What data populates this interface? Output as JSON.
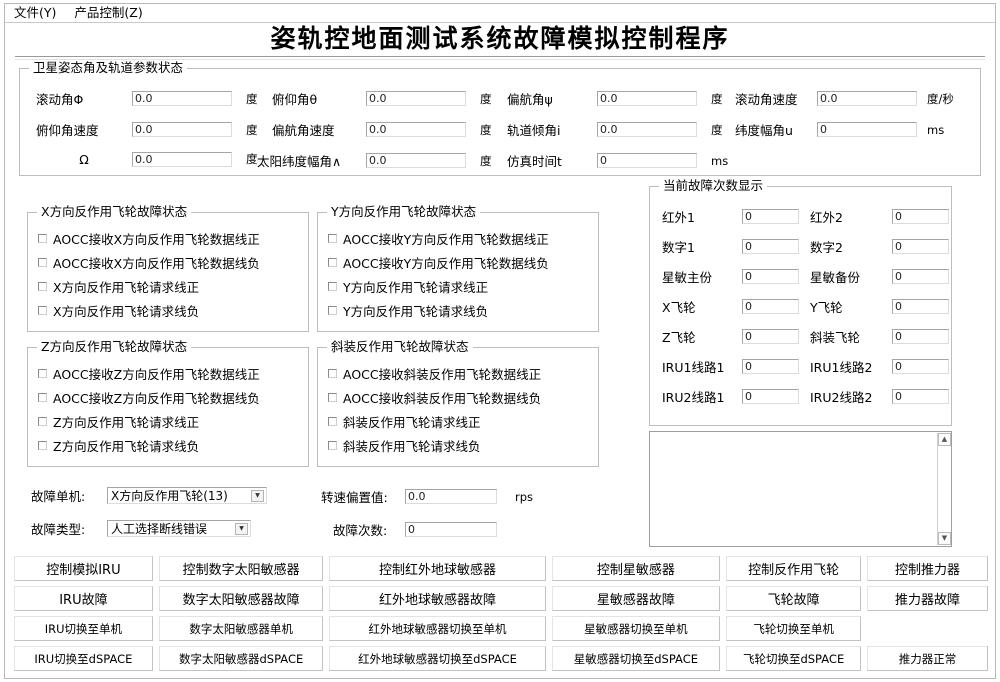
{
  "menu": {
    "items": [
      {
        "label": "文件(Y)",
        "name": "menu-file"
      },
      {
        "label": "产品控制(Z)",
        "name": "menu-product-control"
      }
    ]
  },
  "title": "姿轨控地面测试系统故障模拟控制程序",
  "attitude_group": {
    "legend": "卫星姿态角及轨道参数状态",
    "fields": [
      {
        "label": "滚动角Φ",
        "value": "0.0",
        "unit": "度"
      },
      {
        "label": "俯仰角θ",
        "value": "0.0",
        "unit": "度"
      },
      {
        "label": "偏航角ψ",
        "value": "0.0",
        "unit": "度"
      },
      {
        "label": "滚动角速度",
        "value": "0.0",
        "unit": "度/秒"
      },
      {
        "label": "俯仰角速度",
        "value": "0.0",
        "unit": "度"
      },
      {
        "label": "偏航角速度",
        "value": "0.0",
        "unit": "度"
      },
      {
        "label": "轨道倾角i",
        "value": "0.0",
        "unit": "度"
      },
      {
        "label": "纬度幅角u",
        "value": "0",
        "unit": "ms"
      },
      {
        "label": "Ω",
        "value": "0.0",
        "unit": "度"
      },
      {
        "label": "太阳纬度幅角∧",
        "value": "0.0",
        "unit": "度"
      },
      {
        "label": "仿真时间t",
        "value": "0",
        "unit": "ms"
      }
    ]
  },
  "wheel_groups": [
    {
      "legend": "X方向反作用飞轮故障状态",
      "checks": [
        "AOCC接收X方向反作用飞轮数据线正",
        "AOCC接收X方向反作用飞轮数据线负",
        "X方向反作用飞轮请求线正",
        "X方向反作用飞轮请求线负"
      ]
    },
    {
      "legend": "Y方向反作用飞轮故障状态",
      "checks": [
        "AOCC接收Y方向反作用飞轮数据线正",
        "AOCC接收Y方向反作用飞轮数据线负",
        "Y方向反作用飞轮请求线正",
        "Y方向反作用飞轮请求线负"
      ]
    },
    {
      "legend": "Z方向反作用飞轮故障状态",
      "checks": [
        "AOCC接收Z方向反作用飞轮数据线正",
        "AOCC接收Z方向反作用飞轮数据线负",
        "Z方向反作用飞轮请求线正",
        "Z方向反作用飞轮请求线负"
      ]
    },
    {
      "legend": "斜装反作用飞轮故障状态",
      "checks": [
        "AOCC接收斜装反作用飞轮数据线正",
        "AOCC接收斜装反作用飞轮数据线负",
        "斜装反作用飞轮请求线正",
        "斜装反作用飞轮请求线负"
      ]
    }
  ],
  "fault_count_group": {
    "legend": "当前故障次数显示",
    "rows": [
      [
        {
          "label": "红外1",
          "value": "0"
        },
        {
          "label": "红外2",
          "value": "0"
        }
      ],
      [
        {
          "label": "数字1",
          "value": "0"
        },
        {
          "label": "数字2",
          "value": "0"
        }
      ],
      [
        {
          "label": "星敏主份",
          "value": "0"
        },
        {
          "label": "星敏备份",
          "value": "0"
        }
      ],
      [
        {
          "label": "X飞轮",
          "value": "0"
        },
        {
          "label": "Y飞轮",
          "value": "0"
        }
      ],
      [
        {
          "label": "Z飞轮",
          "value": "0"
        },
        {
          "label": "斜装飞轮",
          "value": "0"
        }
      ],
      [
        {
          "label": "IRU1线路1",
          "value": "0"
        },
        {
          "label": "IRU1线路2",
          "value": "0"
        }
      ],
      [
        {
          "label": "IRU2线路1",
          "value": "0"
        },
        {
          "label": "IRU2线路2",
          "value": "0"
        }
      ]
    ]
  },
  "log": {
    "text": ""
  },
  "fault_selection": {
    "device_label": "故障单机:",
    "device_value": "X方向反作用飞轮(13)",
    "speed_label": "转速偏置值:",
    "speed_value": "0.0",
    "speed_unit": "rps",
    "type_label": "故障类型:",
    "type_value": "人工选择断线错误",
    "count_label": "故障次数:",
    "count_value": "0"
  },
  "buttons": {
    "rows": [
      [
        "控制模拟IRU",
        "控制数字太阳敏感器",
        "控制红外地球敏感器",
        "控制星敏感器",
        "控制反作用飞轮",
        "控制推力器"
      ],
      [
        "IRU故障",
        "数字太阳敏感器故障",
        "红外地球敏感器故障",
        "星敏感器故障",
        "飞轮故障",
        "推力器故障"
      ],
      [
        "IRU切换至单机",
        "数字太阳敏感器单机",
        "红外地球敏感器切换至单机",
        "星敏感器切换至单机",
        "飞轮切换至单机",
        ""
      ],
      [
        "IRU切换至dSPACE",
        "数字太阳敏感器dSPACE",
        "红外地球敏感器切换至dSPACE",
        "星敏感器切换至dSPACE",
        "飞轮切换至dSPACE",
        "推力器正常"
      ]
    ]
  },
  "icons": {
    "dropdown": "▼",
    "scroll_up": "▲",
    "scroll_down": "▼"
  }
}
